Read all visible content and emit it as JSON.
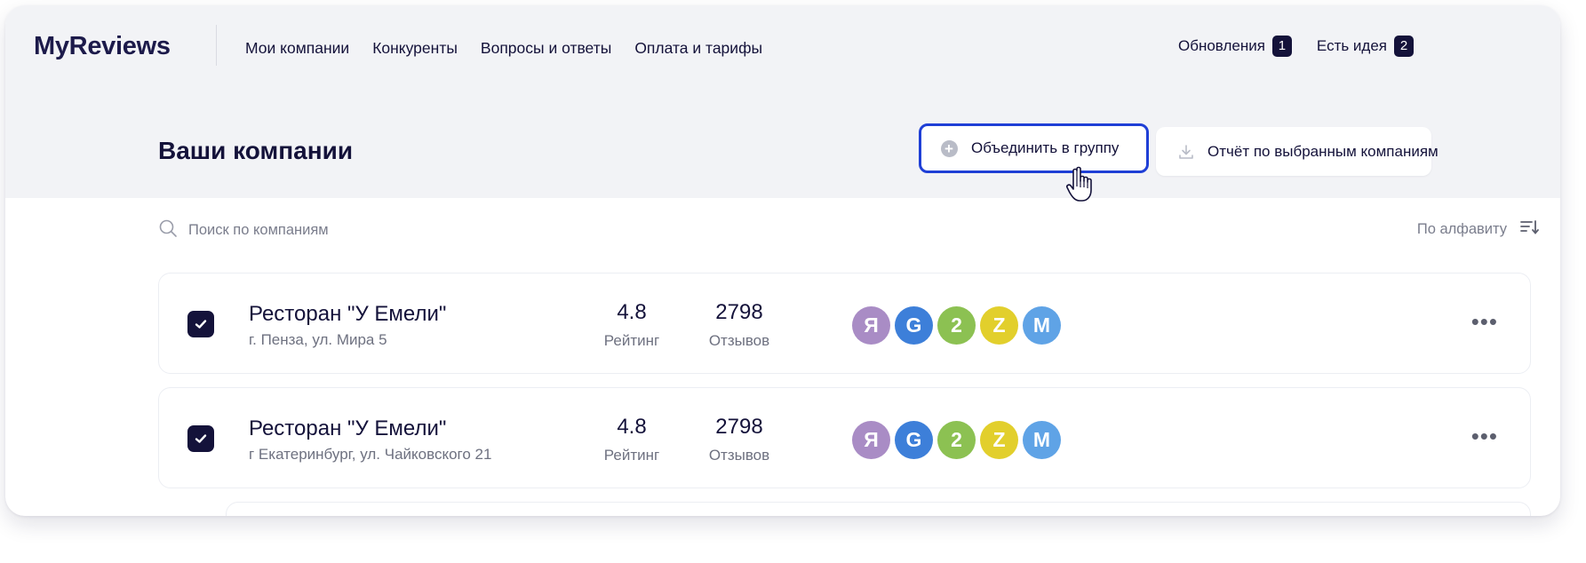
{
  "app": {
    "logo": "MyReviews"
  },
  "nav": {
    "items": [
      "Мои компании",
      "Конкуренты",
      "Вопросы и ответы",
      "Оплата и тарифы"
    ]
  },
  "top_right": {
    "updates": {
      "label": "Обновления",
      "count": "1"
    },
    "idea": {
      "label": "Есть идея",
      "count": "2"
    }
  },
  "page": {
    "title": "Ваши компании"
  },
  "actions": {
    "group_label": "Объединить в группу",
    "report_label": "Отчёт по выбранным компаниям"
  },
  "search": {
    "placeholder": "Поиск по компаниям",
    "value": ""
  },
  "sort": {
    "label": "По алфавиту"
  },
  "companies": [
    {
      "checked": true,
      "name": "Ресторан \"У Емели\"",
      "address": "г. Пенза, ул. Мира 5",
      "rating": "4.8",
      "rating_label": "Рейтинг",
      "reviews": "2798",
      "reviews_label": "Отзывов"
    },
    {
      "checked": true,
      "name": "Ресторан \"У Емели\"",
      "address": "г Екатеринбург, ул. Чайковского 21",
      "rating": "4.8",
      "rating_label": "Рейтинг",
      "reviews": "2798",
      "reviews_label": "Отзывов"
    }
  ],
  "sources": [
    {
      "letter": "Я",
      "icon": "yandex-icon",
      "color": "#a98cc5"
    },
    {
      "letter": "G",
      "icon": "google-icon",
      "color": "#3d7fd9"
    },
    {
      "letter": "2",
      "icon": "2gis-icon",
      "color": "#8cc152"
    },
    {
      "letter": "Z",
      "icon": "zoon-icon",
      "color": "#e2cf2c"
    },
    {
      "letter": "M",
      "icon": "mail-maps-icon",
      "color": "#5fa3e6"
    }
  ],
  "colors": {
    "accent": "#1f3fd6",
    "dark": "#14123a",
    "hero_bg": "#f2f3f6"
  }
}
